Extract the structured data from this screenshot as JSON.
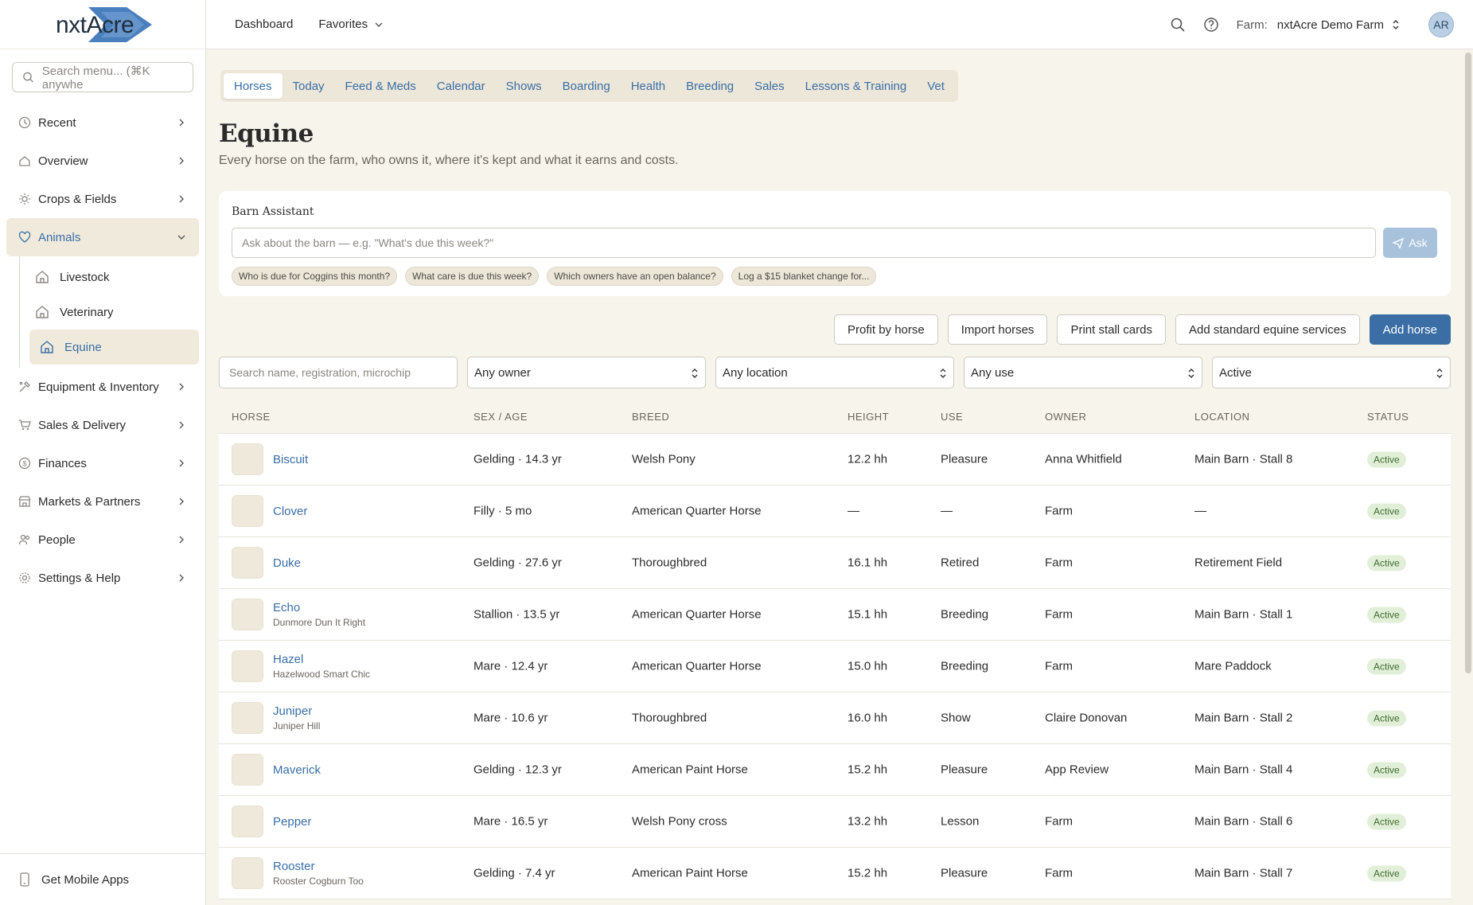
{
  "brand": {
    "logo_text": "nxtAcre"
  },
  "sidebar": {
    "search_placeholder": "Search menu... (⌘K anywhe",
    "items": [
      {
        "label": "Recent",
        "icon": "clock-icon"
      },
      {
        "label": "Overview",
        "icon": "home-icon"
      },
      {
        "label": "Crops & Fields",
        "icon": "sun-icon"
      },
      {
        "label": "Animals",
        "icon": "heart-icon"
      },
      {
        "label": "Equipment & Inventory",
        "icon": "tools-icon"
      },
      {
        "label": "Sales & Delivery",
        "icon": "cart-icon"
      },
      {
        "label": "Finances",
        "icon": "dollar-icon"
      },
      {
        "label": "Markets & Partners",
        "icon": "store-icon"
      },
      {
        "label": "People",
        "icon": "people-icon"
      },
      {
        "label": "Settings & Help",
        "icon": "gear-icon"
      }
    ],
    "animals_sub": [
      {
        "label": "Livestock",
        "icon": "barn-icon"
      },
      {
        "label": "Veterinary",
        "icon": "barn-icon"
      },
      {
        "label": "Equine",
        "icon": "barn-icon"
      }
    ],
    "footer": "Get Mobile Apps"
  },
  "topbar": {
    "dashboard": "Dashboard",
    "favorites": "Favorites",
    "farm_label": "Farm:",
    "farm_name": "nxtAcre Demo Farm",
    "avatar": "AR"
  },
  "tabs": [
    "Horses",
    "Today",
    "Feed & Meds",
    "Calendar",
    "Shows",
    "Boarding",
    "Health",
    "Breeding",
    "Sales",
    "Lessons & Training",
    "Vet"
  ],
  "page": {
    "title": "Equine",
    "subtitle": "Every horse on the farm, who owns it, where it's kept and what it earns and costs."
  },
  "assistant": {
    "title": "Barn Assistant",
    "placeholder": "Ask about the barn — e.g. \"What's due this week?\"",
    "ask": "Ask",
    "chips": [
      "Who is due for Coggins this month?",
      "What care is due this week?",
      "Which owners have an open balance?",
      "Log a $15 blanket change for..."
    ]
  },
  "actions": {
    "profit": "Profit by horse",
    "import": "Import horses",
    "print": "Print stall cards",
    "add_services": "Add standard equine services",
    "add_horse": "Add horse"
  },
  "filters": {
    "search_placeholder": "Search name, registration, microchip",
    "owner": "Any owner",
    "location": "Any location",
    "use": "Any use",
    "status": "Active"
  },
  "table": {
    "headers": {
      "horse": "HORSE",
      "sex": "SEX / AGE",
      "breed": "BREED",
      "height": "HEIGHT",
      "use": "USE",
      "owner": "OWNER",
      "location": "LOCATION",
      "status": "STATUS"
    },
    "rows": [
      {
        "name": "Biscuit",
        "reg": "",
        "sex": "Gelding · 14.3 yr",
        "breed": "Welsh Pony",
        "height": "12.2 hh",
        "use": "Pleasure",
        "owner": "Anna Whitfield",
        "location": "Main Barn · Stall 8",
        "status": "Active"
      },
      {
        "name": "Clover",
        "reg": "",
        "sex": "Filly · 5 mo",
        "breed": "American Quarter Horse",
        "height": "—",
        "use": "—",
        "owner": "Farm",
        "location": "—",
        "status": "Active"
      },
      {
        "name": "Duke",
        "reg": "",
        "sex": "Gelding · 27.6 yr",
        "breed": "Thoroughbred",
        "height": "16.1 hh",
        "use": "Retired",
        "owner": "Farm",
        "location": "Retirement Field",
        "status": "Active"
      },
      {
        "name": "Echo",
        "reg": "Dunmore Dun It Right",
        "sex": "Stallion · 13.5 yr",
        "breed": "American Quarter Horse",
        "height": "15.1 hh",
        "use": "Breeding",
        "owner": "Farm",
        "location": "Main Barn · Stall 1",
        "status": "Active"
      },
      {
        "name": "Hazel",
        "reg": "Hazelwood Smart Chic",
        "sex": "Mare · 12.4 yr",
        "breed": "American Quarter Horse",
        "height": "15.0 hh",
        "use": "Breeding",
        "owner": "Farm",
        "location": "Mare Paddock",
        "status": "Active"
      },
      {
        "name": "Juniper",
        "reg": "Juniper Hill",
        "sex": "Mare · 10.6 yr",
        "breed": "Thoroughbred",
        "height": "16.0 hh",
        "use": "Show",
        "owner": "Claire Donovan",
        "location": "Main Barn · Stall 2",
        "status": "Active"
      },
      {
        "name": "Maverick",
        "reg": "",
        "sex": "Gelding · 12.3 yr",
        "breed": "American Paint Horse",
        "height": "15.2 hh",
        "use": "Pleasure",
        "owner": "App Review",
        "location": "Main Barn · Stall 4",
        "status": "Active"
      },
      {
        "name": "Pepper",
        "reg": "",
        "sex": "Mare · 16.5 yr",
        "breed": "Welsh Pony cross",
        "height": "13.2 hh",
        "use": "Lesson",
        "owner": "Farm",
        "location": "Main Barn · Stall 6",
        "status": "Active"
      },
      {
        "name": "Rooster",
        "reg": "Rooster Cogburn Too",
        "sex": "Gelding · 7.4 yr",
        "breed": "American Paint Horse",
        "height": "15.2 hh",
        "use": "Pleasure",
        "owner": "Farm",
        "location": "Main Barn · Stall 7",
        "status": "Active"
      }
    ]
  },
  "colors": {
    "accent": "#3a6ea5",
    "background": "#f7f4ec",
    "badge_bg": "#e2efd8",
    "badge_text": "#3e6b2e"
  }
}
